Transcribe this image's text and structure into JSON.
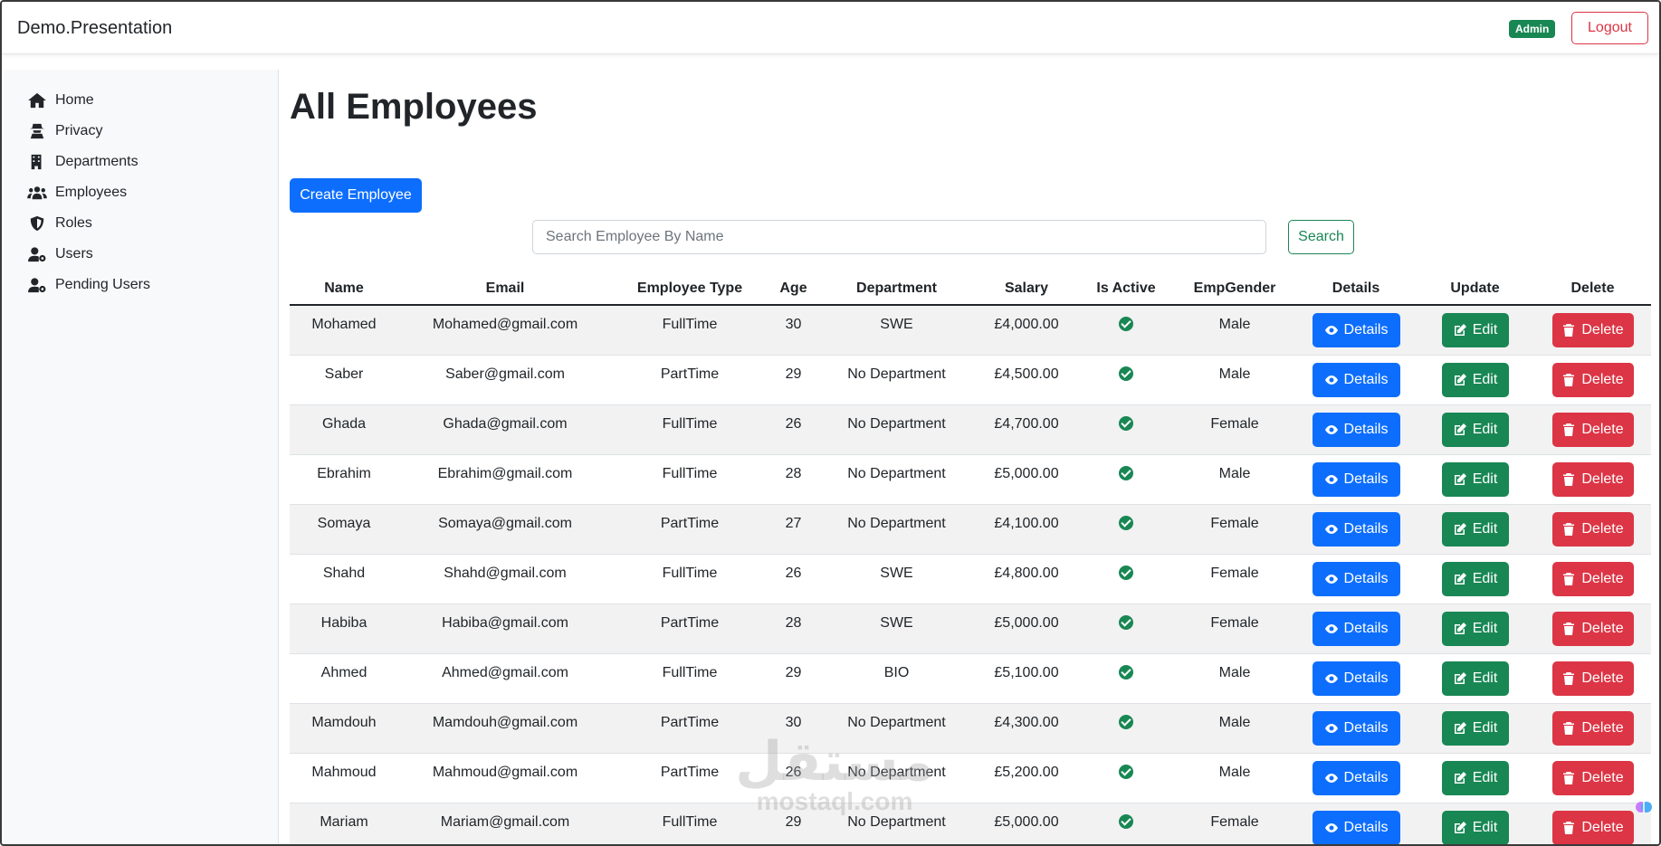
{
  "navbar": {
    "brand": "Demo.Presentation",
    "role_badge": "Admin",
    "logout_label": "Logout"
  },
  "sidebar": {
    "items": [
      {
        "label": "Home",
        "icon": "home-icon"
      },
      {
        "label": "Privacy",
        "icon": "user-secret-icon"
      },
      {
        "label": "Departments",
        "icon": "building-icon"
      },
      {
        "label": "Employees",
        "icon": "users-icon"
      },
      {
        "label": "Roles",
        "icon": "shield-icon"
      },
      {
        "label": "Users",
        "icon": "user-gear-icon"
      },
      {
        "label": "Pending Users",
        "icon": "user-gear-icon"
      }
    ]
  },
  "main": {
    "title": "All Employees",
    "create_label": "Create Employee",
    "search": {
      "placeholder": "Search Employee By Name",
      "value": "",
      "button_label": "Search"
    }
  },
  "table": {
    "headers": [
      "Name",
      "Email",
      "Employee Type",
      "Age",
      "Department",
      "Salary",
      "Is Active",
      "EmpGender",
      "Details",
      "Update",
      "Delete"
    ],
    "buttons": {
      "details": "Details",
      "edit": "Edit",
      "delete": "Delete"
    },
    "rows": [
      {
        "name": "Mohamed",
        "email": "Mohamed@gmail.com",
        "type": "FullTime",
        "age": "30",
        "department": "SWE",
        "salary": "£4,000.00",
        "active": true,
        "gender": "Male"
      },
      {
        "name": "Saber",
        "email": "Saber@gmail.com",
        "type": "PartTime",
        "age": "29",
        "department": "No Department",
        "salary": "£4,500.00",
        "active": true,
        "gender": "Male"
      },
      {
        "name": "Ghada",
        "email": "Ghada@gmail.com",
        "type": "FullTime",
        "age": "26",
        "department": "No Department",
        "salary": "£4,700.00",
        "active": true,
        "gender": "Female"
      },
      {
        "name": "Ebrahim",
        "email": "Ebrahim@gmail.com",
        "type": "FullTime",
        "age": "28",
        "department": "No Department",
        "salary": "£5,000.00",
        "active": true,
        "gender": "Male"
      },
      {
        "name": "Somaya",
        "email": "Somaya@gmail.com",
        "type": "PartTime",
        "age": "27",
        "department": "No Department",
        "salary": "£4,100.00",
        "active": true,
        "gender": "Female"
      },
      {
        "name": "Shahd",
        "email": "Shahd@gmail.com",
        "type": "FullTime",
        "age": "26",
        "department": "SWE",
        "salary": "£4,800.00",
        "active": true,
        "gender": "Female"
      },
      {
        "name": "Habiba",
        "email": "Habiba@gmail.com",
        "type": "PartTime",
        "age": "28",
        "department": "SWE",
        "salary": "£5,000.00",
        "active": true,
        "gender": "Female"
      },
      {
        "name": "Ahmed",
        "email": "Ahmed@gmail.com",
        "type": "FullTime",
        "age": "29",
        "department": "BIO",
        "salary": "£5,100.00",
        "active": true,
        "gender": "Male"
      },
      {
        "name": "Mamdouh",
        "email": "Mamdouh@gmail.com",
        "type": "PartTime",
        "age": "30",
        "department": "No Department",
        "salary": "£4,300.00",
        "active": true,
        "gender": "Male"
      },
      {
        "name": "Mahmoud",
        "email": "Mahmoud@gmail.com",
        "type": "PartTime",
        "age": "26",
        "department": "No Department",
        "salary": "£5,200.00",
        "active": true,
        "gender": "Male"
      },
      {
        "name": "Mariam",
        "email": "Mariam@gmail.com",
        "type": "FullTime",
        "age": "29",
        "department": "No Department",
        "salary": "£5,000.00",
        "active": true,
        "gender": "Female"
      }
    ]
  },
  "watermark": {
    "arabic": "مستقل",
    "latin": "mostaql.com"
  },
  "colors": {
    "primary": "#0d6efd",
    "success": "#198754",
    "danger": "#dc3545",
    "sidebar_bg": "#f8f9fa"
  }
}
